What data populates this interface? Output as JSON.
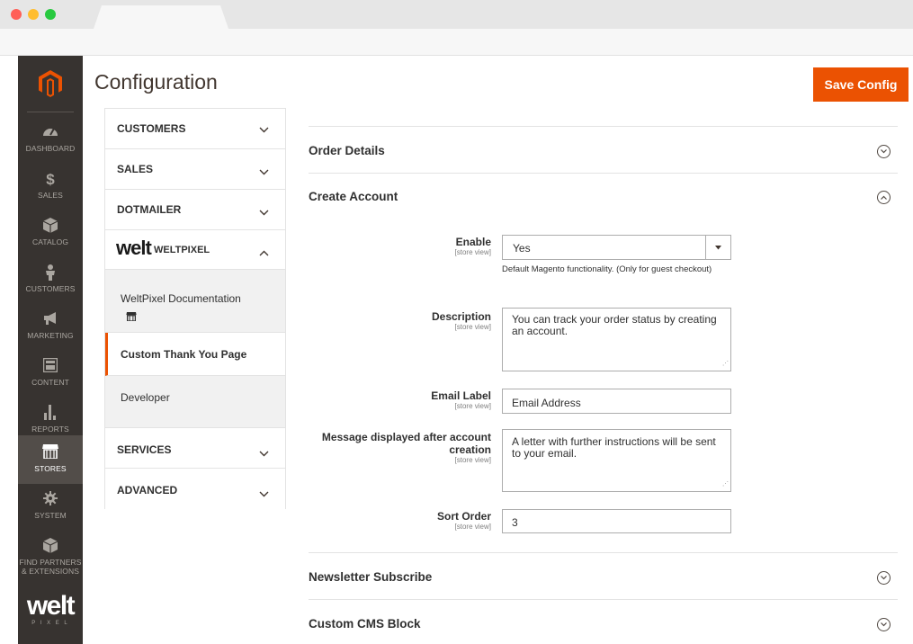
{
  "admin_nav": {
    "items": [
      {
        "label": "DASHBOARD",
        "icon": "dashboard-icon"
      },
      {
        "label": "SALES",
        "icon": "dollar-icon"
      },
      {
        "label": "CATALOG",
        "icon": "box-icon"
      },
      {
        "label": "CUSTOMERS",
        "icon": "person-icon"
      },
      {
        "label": "MARKETING",
        "icon": "megaphone-icon"
      },
      {
        "label": "CONTENT",
        "icon": "layout-icon"
      },
      {
        "label": "REPORTS",
        "icon": "bar-chart-icon"
      },
      {
        "label": "STORES",
        "icon": "store-icon"
      },
      {
        "label": "SYSTEM",
        "icon": "gear-icon"
      },
      {
        "label": "FIND PARTNERS",
        "label2": "& EXTENSIONS",
        "icon": "box-icon"
      }
    ],
    "brand": "welt",
    "brand_sub": "P I X E L"
  },
  "header": {
    "title": "Configuration",
    "save_label": "Save Config"
  },
  "tabs": {
    "customers": "CUSTOMERS",
    "sales": "SALES",
    "dotmailer": "DOTMAILER",
    "weltpixel_logo": "welt",
    "weltpixel": "WELTPIXEL",
    "documentation": "WeltPixel Documentation",
    "custom_thank_you": "Custom Thank You Page",
    "developer": "Developer",
    "services": "SERVICES",
    "advanced": "ADVANCED"
  },
  "sections": {
    "order_details": "Order Details",
    "create_account": "Create Account",
    "newsletter": "Newsletter Subscribe",
    "cms_block": "Custom CMS Block"
  },
  "form": {
    "scope": "[store view]",
    "enable": {
      "label": "Enable",
      "value": "Yes",
      "note": "Default Magento functionality. (Only for guest checkout)"
    },
    "description": {
      "label": "Description",
      "value": "You can track your order status by creating an account."
    },
    "email_label": {
      "label": "Email Label",
      "value": "Email Address"
    },
    "message": {
      "label": "Message displayed after account creation",
      "value": "A letter with further instructions will be sent to your email."
    },
    "sort_order": {
      "label": "Sort Order",
      "value": "3"
    }
  },
  "colors": {
    "accent": "#eb5202",
    "sidebar": "#373330"
  }
}
